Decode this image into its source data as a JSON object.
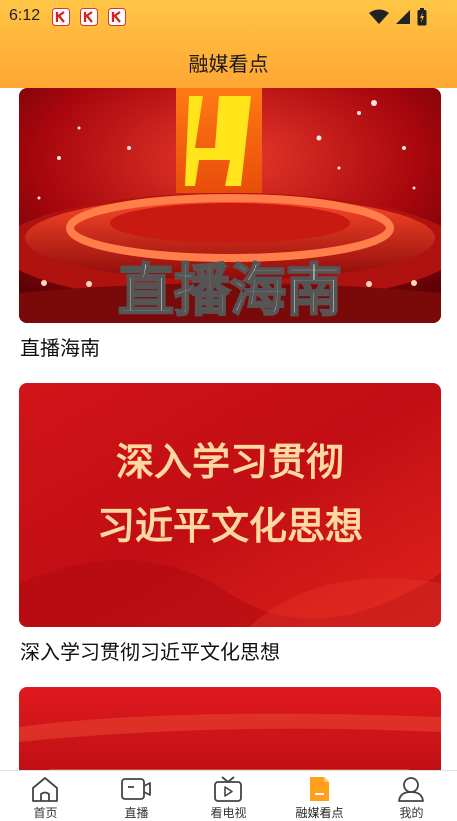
{
  "status_bar": {
    "time": "6:12"
  },
  "header": {
    "title": "融媒看点"
  },
  "feed": {
    "items": [
      {
        "title": "直播海南",
        "image_text": "直播海南"
      },
      {
        "title": "深入学习贯彻习近平文化思想",
        "image_text_line1": "深入学习贯彻",
        "image_text_line2": "习近平文化思想"
      },
      {
        "title": ""
      }
    ]
  },
  "bottom_nav": {
    "items": [
      {
        "label": "首页",
        "icon": "home-icon"
      },
      {
        "label": "直播",
        "icon": "video-camera-icon"
      },
      {
        "label": "看电视",
        "icon": "tv-icon"
      },
      {
        "label": "融媒看点",
        "icon": "document-icon",
        "active": true
      },
      {
        "label": "我的",
        "icon": "user-icon"
      }
    ],
    "active_color": "#ff9f1a"
  },
  "colors": {
    "header_top": "#ffc646",
    "header_bottom": "#ffa733",
    "banner_red": "#d4141b"
  }
}
